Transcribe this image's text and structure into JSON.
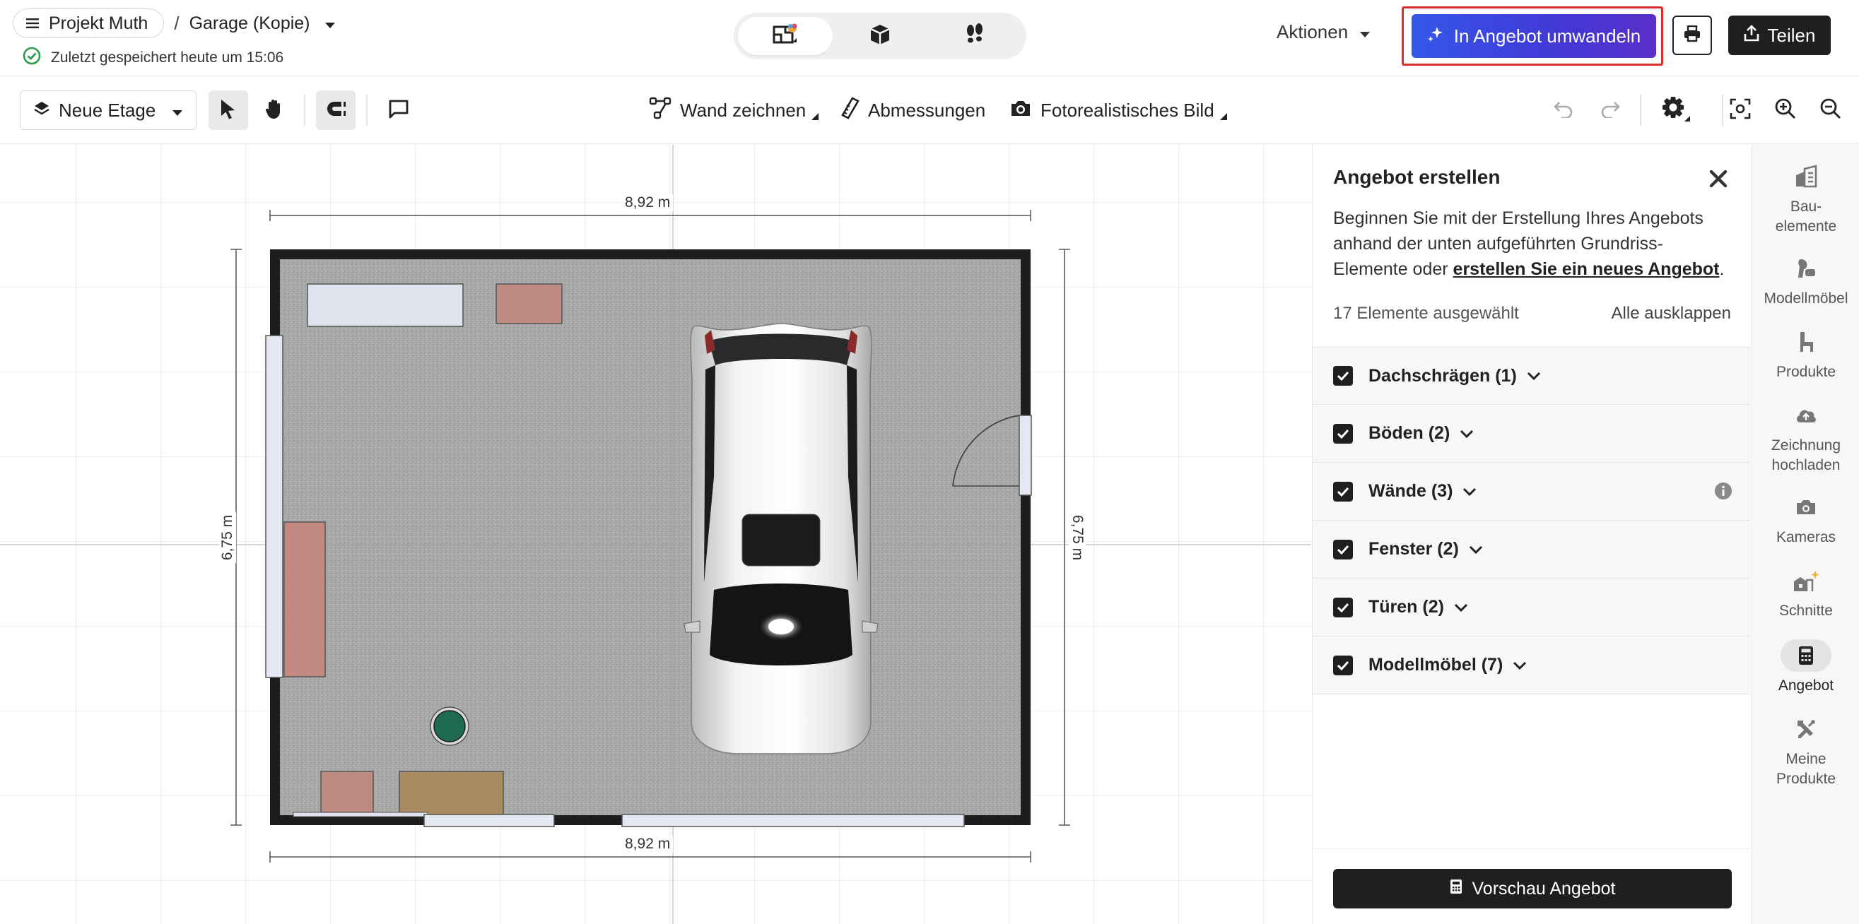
{
  "header": {
    "menu_label": "Projekt Muth",
    "separator": "/",
    "project_name": "Garage (Kopie)",
    "saved_status": "Zuletzt gespeichert heute um 15:06",
    "actions_label": "Aktionen",
    "convert_button": "In Angebot umwandeln",
    "share_button": "Teilen",
    "view_modes": [
      "2d-floorplan-icon",
      "3d-box-icon",
      "walkthrough-footsteps-icon"
    ],
    "active_view": 0
  },
  "toolbar": {
    "floor_label": "Neue Etage",
    "draw_wall": "Wand zeichnen",
    "dimensions": "Abmessungen",
    "photo_image": "Fotorealistisches Bild"
  },
  "canvas": {
    "dim_top": "8,92 m",
    "dim_bottom": "8,92 m",
    "dim_left": "6,75 m",
    "dim_right": "6,75 m"
  },
  "panel": {
    "title": "Angebot erstellen",
    "desc_before": "Beginnen Sie mit der Erstellung Ihres Angebots anhand der unten aufgeführten Grundriss-Elemente oder ",
    "desc_link": "erstellen Sie ein neues Angebot",
    "desc_after": ".",
    "selected_count": "17 Elemente ausgewählt",
    "expand_all": "Alle ausklappen",
    "categories": [
      {
        "label": "Dachschrägen (1)",
        "checked": true,
        "info": false
      },
      {
        "label": "Böden (2)",
        "checked": true,
        "info": false
      },
      {
        "label": "Wände (3)",
        "checked": true,
        "info": true
      },
      {
        "label": "Fenster (2)",
        "checked": true,
        "info": false
      },
      {
        "label": "Türen (2)",
        "checked": true,
        "info": false
      },
      {
        "label": "Modellmöbel (7)",
        "checked": true,
        "info": false
      }
    ],
    "preview_button": "Vorschau Angebot"
  },
  "rail": [
    {
      "label": "Bau-\nelemente",
      "icon": "building-elements-icon"
    },
    {
      "label": "Modellmöbel",
      "icon": "furniture-icon"
    },
    {
      "label": "Produkte",
      "icon": "chair-icon"
    },
    {
      "label": "Zeichnung\nhochladen",
      "icon": "cloud-upload-icon"
    },
    {
      "label": "Kameras",
      "icon": "camera-icon"
    },
    {
      "label": "Schnitte",
      "icon": "section-sparkle-icon"
    },
    {
      "label": "Angebot",
      "icon": "calculator-icon",
      "active": true
    },
    {
      "label": "Meine\nProdukte",
      "icon": "tools-icon"
    }
  ],
  "colors": {
    "accent_gradient_start": "#3557e8",
    "accent_gradient_end": "#5a2fc9",
    "highlight_outline": "#d7302a",
    "saved_check": "#2e9a4a",
    "dark_button": "#1f1f1f"
  }
}
